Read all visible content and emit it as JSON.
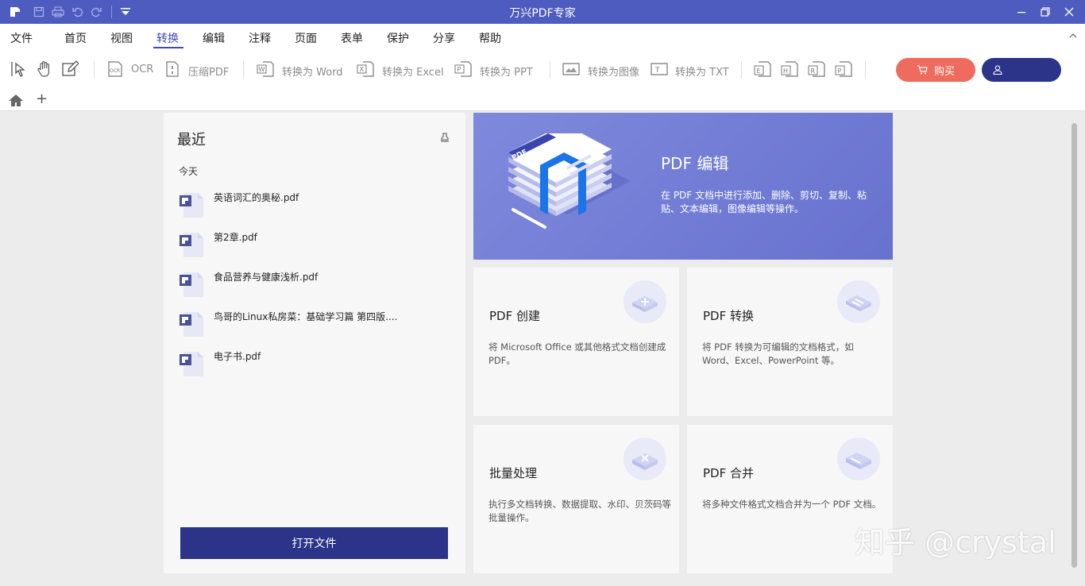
{
  "window": {
    "title": "万兴PDF专家"
  },
  "menu": [
    "文件",
    "首页",
    "视图",
    "转换",
    "编辑",
    "注释",
    "页面",
    "表单",
    "保护",
    "分享",
    "帮助"
  ],
  "toolbar": {
    "ocr": "OCR",
    "compress": "压缩PDF",
    "to_word": "转换为 Word",
    "to_excel": "转换为 Excel",
    "to_ppt": "转换为 PPT",
    "to_image": "转换为图像",
    "to_txt": "转换为 TXT",
    "buy": "购买"
  },
  "recent": {
    "title": "最近",
    "group": "今天",
    "files": [
      "英语词汇的奥秘.pdf",
      "第2章.pdf",
      "食品营养与健康浅析.pdf",
      "鸟哥的Linux私房菜：基础学习篇 第四版....",
      "电子书.pdf"
    ],
    "open_button": "打开文件"
  },
  "cards": {
    "edit": {
      "title": "PDF 编辑",
      "desc": "在 PDF 文档中进行添加、删除、剪切、复制、粘贴、文本编辑，图像编辑等操作。"
    },
    "create": {
      "title": "PDF 创建",
      "desc": "将 Microsoft Office 或其他格式文档创建成 PDF。"
    },
    "convert": {
      "title": "PDF 转换",
      "desc": "将 PDF 转换为可编辑的文档格式，如 Word、Excel、PowerPoint 等。"
    },
    "batch": {
      "title": "批量处理",
      "desc": "执行多文档转换、数据提取、水印、贝茨码等批量操作。"
    },
    "merge": {
      "title": "PDF 合并",
      "desc": "将多种文件格式文档合并为一个 PDF 文档。"
    }
  },
  "watermark": "知乎 @crystal",
  "colors": {
    "titlebar": "#4f5cbf",
    "primary": "#2b3489",
    "buy": "#ee6b5e",
    "hero": "#7380d6"
  }
}
